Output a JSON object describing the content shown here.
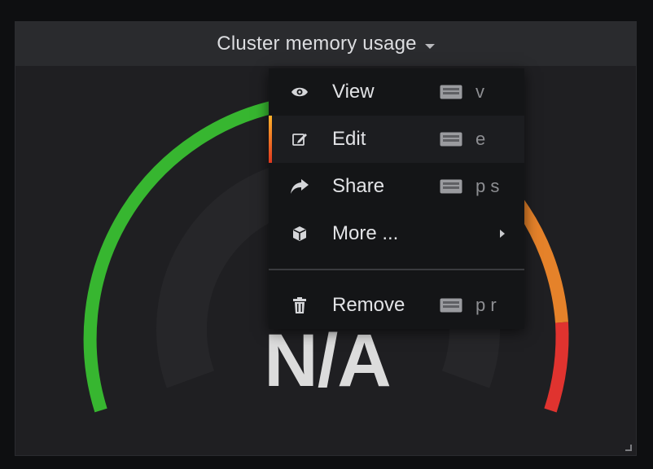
{
  "panel": {
    "title": "Cluster memory usage",
    "value": "N/A"
  },
  "gauge": {
    "colors": {
      "green": "#37b630",
      "orange": "#e5822a",
      "red": "#e0332f"
    }
  },
  "menu": {
    "items": [
      {
        "label": "View",
        "shortcut": "v",
        "icon": "eye-icon"
      },
      {
        "label": "Edit",
        "shortcut": "e",
        "icon": "edit-icon"
      },
      {
        "label": "Share",
        "shortcut": "p s",
        "icon": "share-icon"
      },
      {
        "label": "More ...",
        "icon": "cube-icon"
      },
      {
        "label": "Remove",
        "shortcut": "p r",
        "icon": "trash-icon"
      }
    ]
  }
}
